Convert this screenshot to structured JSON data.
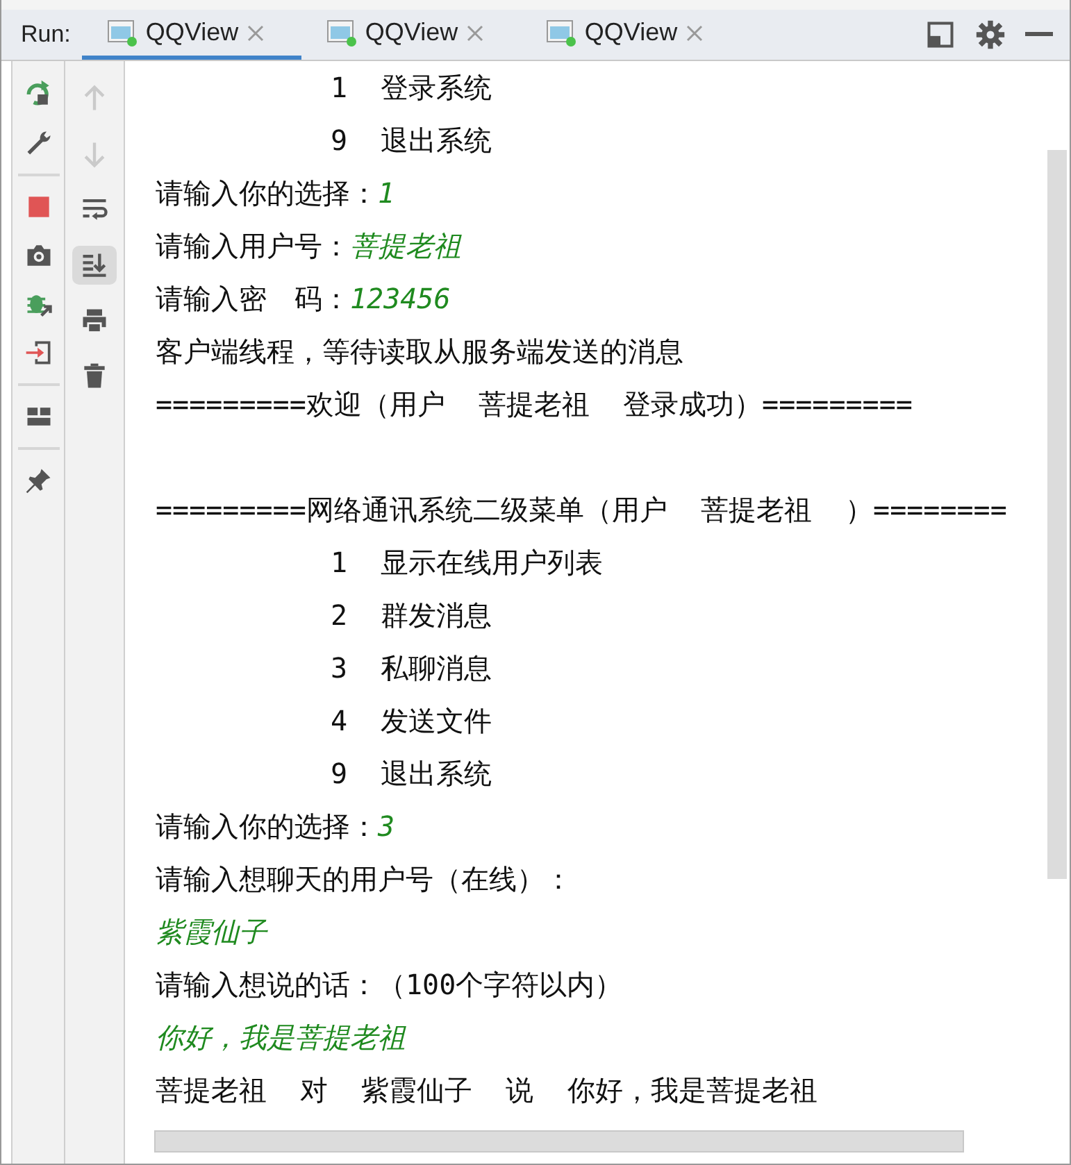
{
  "panel": {
    "title": "Run:"
  },
  "tabs": [
    {
      "label": "QQView",
      "selected": true
    },
    {
      "label": "QQView",
      "selected": false
    },
    {
      "label": "QQView",
      "selected": false
    }
  ],
  "toolbar_primary": [
    {
      "kind": "rerun"
    },
    {
      "kind": "wrench"
    },
    {
      "kind": "separator"
    },
    {
      "kind": "stop"
    },
    {
      "kind": "camera"
    },
    {
      "kind": "debug"
    },
    {
      "kind": "exit"
    },
    {
      "kind": "separator"
    },
    {
      "kind": "layout"
    },
    {
      "kind": "separator"
    },
    {
      "kind": "pin"
    }
  ],
  "toolbar_secondary": [
    {
      "kind": "up",
      "disabled": true,
      "selected": false
    },
    {
      "kind": "down",
      "disabled": true,
      "selected": false
    },
    {
      "kind": "wrap",
      "disabled": false,
      "selected": false
    },
    {
      "kind": "scroll-end",
      "disabled": false,
      "selected": true
    },
    {
      "kind": "print",
      "disabled": false,
      "selected": false
    },
    {
      "kind": "trash",
      "disabled": false,
      "selected": false
    }
  ],
  "console": {
    "lines": [
      {
        "kind": "menu",
        "number": "1",
        "text": "登录系统"
      },
      {
        "kind": "menu",
        "number": "9",
        "text": "退出系统"
      },
      {
        "kind": "output",
        "text": "请输入你的选择：",
        "input": "1"
      },
      {
        "kind": "output",
        "text": "请输入用户号：",
        "input": "菩提老祖"
      },
      {
        "kind": "output",
        "text": "请输入密　码：",
        "input": "123456"
      },
      {
        "kind": "output",
        "text": "客户端线程，等待读取从服务端发送的消息"
      },
      {
        "kind": "output",
        "text": "=========欢迎（用户  菩提老祖  登录成功）========="
      },
      {
        "kind": "output",
        "gap_before": true,
        "text": "=========网络通讯系统二级菜单（用户  菩提老祖  ）========"
      },
      {
        "kind": "menu",
        "number": "1",
        "text": "显示在线用户列表"
      },
      {
        "kind": "menu",
        "number": "2",
        "text": "群发消息"
      },
      {
        "kind": "menu",
        "number": "3",
        "text": "私聊消息"
      },
      {
        "kind": "menu",
        "number": "4",
        "text": "发送文件"
      },
      {
        "kind": "menu",
        "number": "9",
        "text": "退出系统"
      },
      {
        "kind": "output",
        "text": "请输入你的选择：",
        "input": "3"
      },
      {
        "kind": "output",
        "text": "请输入想聊天的用户号（在线）："
      },
      {
        "kind": "input",
        "input": "紫霞仙子"
      },
      {
        "kind": "output",
        "text": "请输入想说的话：（100个字符以内）"
      },
      {
        "kind": "input",
        "input": "你好，我是菩提老祖"
      },
      {
        "kind": "output",
        "text": "菩提老祖  对  紫霞仙子  说  你好，我是菩提老祖"
      }
    ]
  }
}
